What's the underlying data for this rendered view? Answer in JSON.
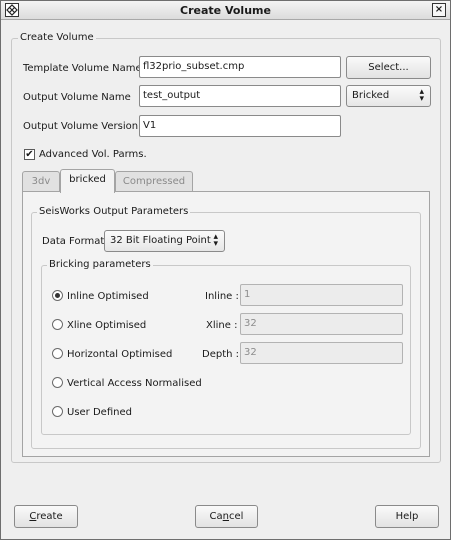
{
  "window": {
    "title": "Create Volume",
    "close_glyph": "×"
  },
  "create_group": {
    "title": "Create Volume"
  },
  "template": {
    "label": "Template Volume Name",
    "value": "fl32prio_subset.cmp",
    "select_label": "Select..."
  },
  "output": {
    "label": "Output Volume Name",
    "value": "test_output",
    "format_value": "Bricked"
  },
  "version": {
    "label": "Output Volume Version",
    "value": "V1"
  },
  "advanced": {
    "label": "Advanced Vol. Parms.",
    "checked": true,
    "check_glyph": "✔"
  },
  "tabs": [
    {
      "label": "3dv",
      "active": false
    },
    {
      "label": "bricked",
      "active": true
    },
    {
      "label": "Compressed",
      "active": false
    }
  ],
  "seisworks": {
    "title": "SeisWorks Output Parameters",
    "data_format_label": "Data Format",
    "data_format_value": "32 Bit Floating Point"
  },
  "bricking": {
    "title": "Bricking parameters",
    "options": [
      {
        "label": "Inline Optimised",
        "selected": true
      },
      {
        "label": "Xline Optimised",
        "selected": false
      },
      {
        "label": "Horizontal Optimised",
        "selected": false
      },
      {
        "label": "Vertical Access Normalised",
        "selected": false
      },
      {
        "label": "User Defined",
        "selected": false
      }
    ],
    "fields": [
      {
        "label": "Inline :",
        "value": "1"
      },
      {
        "label": "Xline :",
        "value": "32"
      },
      {
        "label": "Depth :",
        "value": "32"
      }
    ]
  },
  "buttons": {
    "create_mnemonic": "C",
    "create_rest": "reate",
    "cancel_pre": "Ca",
    "cancel_mnemonic": "n",
    "cancel_post": "cel",
    "help": "Help"
  },
  "icons": {
    "combo_arrow": "▴▾"
  }
}
